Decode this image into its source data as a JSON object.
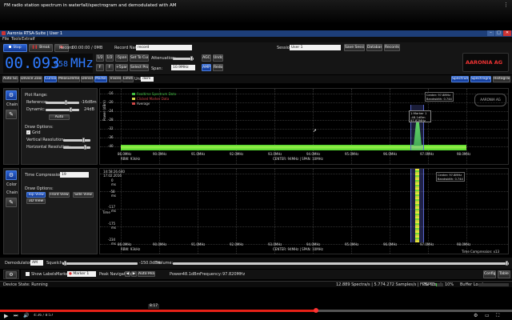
{
  "video": {
    "title": "FM radio station spectrum in waterfall/spectrogram and demodulated with AM",
    "time": "4:36 / 8:57",
    "hover_time": "8:17",
    "progress": 0.615
  },
  "window": {
    "title": "Aaronia RTSA-Suite | User 1",
    "menu": [
      "File",
      "Tools",
      "Extras",
      "?"
    ]
  },
  "toolbar": {
    "stop_label": "Stop",
    "break_label": "Break",
    "record_label": "Record",
    "record_time": "00:00:00 / 0MB",
    "record_name_label": "Record Name:",
    "record_name_value": "record",
    "session_label": "Session:",
    "session_value": "User 1",
    "save_session_label": "Save Session",
    "database_label": "Database",
    "records_label": "Records",
    "attenuation_label": "Attenuation:",
    "span_label": "Span:",
    "span_value": "10.9MHz",
    "agc_label": "AGC",
    "undo_label": "Undo",
    "amp_label": "AMP",
    "redo_label": "Redo",
    "brand": "AARONIA AG",
    "step_buttons": [
      "1/2",
      "1/2",
      "-5pan",
      "Set To Cursor",
      "F",
      "F",
      "+5pan",
      "Select Profile"
    ]
  },
  "frequency": {
    "main": "00.093",
    "sub": "958",
    "unit": "MHz"
  },
  "tabs": {
    "left": [
      "Auto Scale",
      "Device Zoom",
      "Cursor",
      "Measurement",
      "Density",
      "Marker",
      "Traces",
      "Limits",
      "Unit:"
    ],
    "unit_value": "dBm",
    "right": [
      "Spectrum",
      "Spectrogram",
      "Histogram"
    ]
  },
  "side_tabs": [
    "Chain",
    "Color",
    "Chain"
  ],
  "spectrum_panel": {
    "plot_range_label": "Plot Range:",
    "reference_label": "Reference:",
    "reference_value": "-16dBm",
    "dynamic_label": "Dynamic:",
    "dynamic_value": "24dB",
    "auto_label": "Auto",
    "draw_options_label": "Draw Options:",
    "grid_label": "Grid",
    "vertical_resolution_label": "Vertical Resolution:",
    "horizontal_resolution_label": "Horizontal Resolution:"
  },
  "spectrogram_panel": {
    "time_compression_label": "Time Compression:",
    "time_compression_value": "19",
    "draw_options_label": "Draw Options:",
    "view_buttons": [
      "Top View",
      "Front View",
      "Side View",
      "3D View"
    ]
  },
  "spectrum": {
    "y_label": "Power (dBm)",
    "y_ticks": [
      "-16",
      "-20",
      "-24",
      "-28",
      "-32",
      "-36",
      "-40"
    ],
    "x_ticks": [
      "86.0MHz",
      "90.0MHz",
      "91.0MHz",
      "92.0MHz",
      "93.0MHz",
      "94.0MHz",
      "95.0MHz",
      "96.0MHz",
      "97.0MHz",
      "98.0MHz"
    ],
    "rbw": "RBW: 93kHz",
    "center_span": "CENTER: 94MHz  |  SPAN: 10MHz",
    "legend": [
      "Realtime Spectrum Data",
      "Clicked Marker Data",
      "Average"
    ],
    "legend_colors": [
      "#3fbf3f",
      "#d8d84a",
      "#d04848"
    ],
    "marker_title": "1:Marker 1",
    "marker_level": "-48.1dBm",
    "marker_freq": "97.82MHz",
    "center_box": [
      "Center: 97.8MHz",
      "Bandwidth: 0.744MHz"
    ]
  },
  "spectrogram": {
    "y_label": "Time",
    "time_top": "14:58:26.640",
    "date_top": "17.02.2016",
    "y_ticks": [
      "0",
      "-58",
      "-117",
      "-175",
      "-234"
    ],
    "y_units": [
      "ms",
      "ms",
      "ms",
      "ms",
      "ms"
    ],
    "x_ticks": [
      "86.0MHz",
      "90.0MHz",
      "91.0MHz",
      "92.0MHz",
      "93.0MHz",
      "94.0MHz",
      "95.0MHz",
      "96.0MHz",
      "97.0MHz",
      "98.0MHz"
    ],
    "rbw": "RBW: 93kHz",
    "center_span": "CENTER: 94MHz  |  SPAN: 10MHz",
    "time_compression": "Time Compression: x13",
    "center_box": [
      "Center: 97.8MHz",
      "Bandwidth: 0.744MHz"
    ]
  },
  "demod": {
    "demodulator_label": "Demodulator:",
    "demodulator_value": "AM",
    "squelch_label": "Squelch:",
    "squelch_value": "-150.0dBm",
    "volume_label": "Volume:"
  },
  "marker_bar": {
    "show_labels": "Show Labels",
    "marker_label": "Marker:",
    "marker_value": "Marker 1",
    "peak_nav_label": "Peak Navigation:",
    "auto_peak_label": "Auto Peak",
    "power_label": "Power:",
    "power_value": "-48.1dBm",
    "frequency_label": "Frequency:",
    "frequency_value": "97.820MHz",
    "config_label": "Config",
    "table_label": "Table"
  },
  "status": {
    "device_state": "Device State: Running",
    "spectra": "12.889 Spectra/s | 5.774.272 Samples/s | FPS: 63",
    "dsp_load_label": "DSP Load:",
    "dsp_load_value": "10%",
    "buffer_load_label": "Buffer Load:"
  },
  "colors": {
    "accent_blue": "#1e50c8",
    "freq_blue": "#2f7bff",
    "noise_green": "#66e832",
    "youtube_red": "#e62117"
  }
}
